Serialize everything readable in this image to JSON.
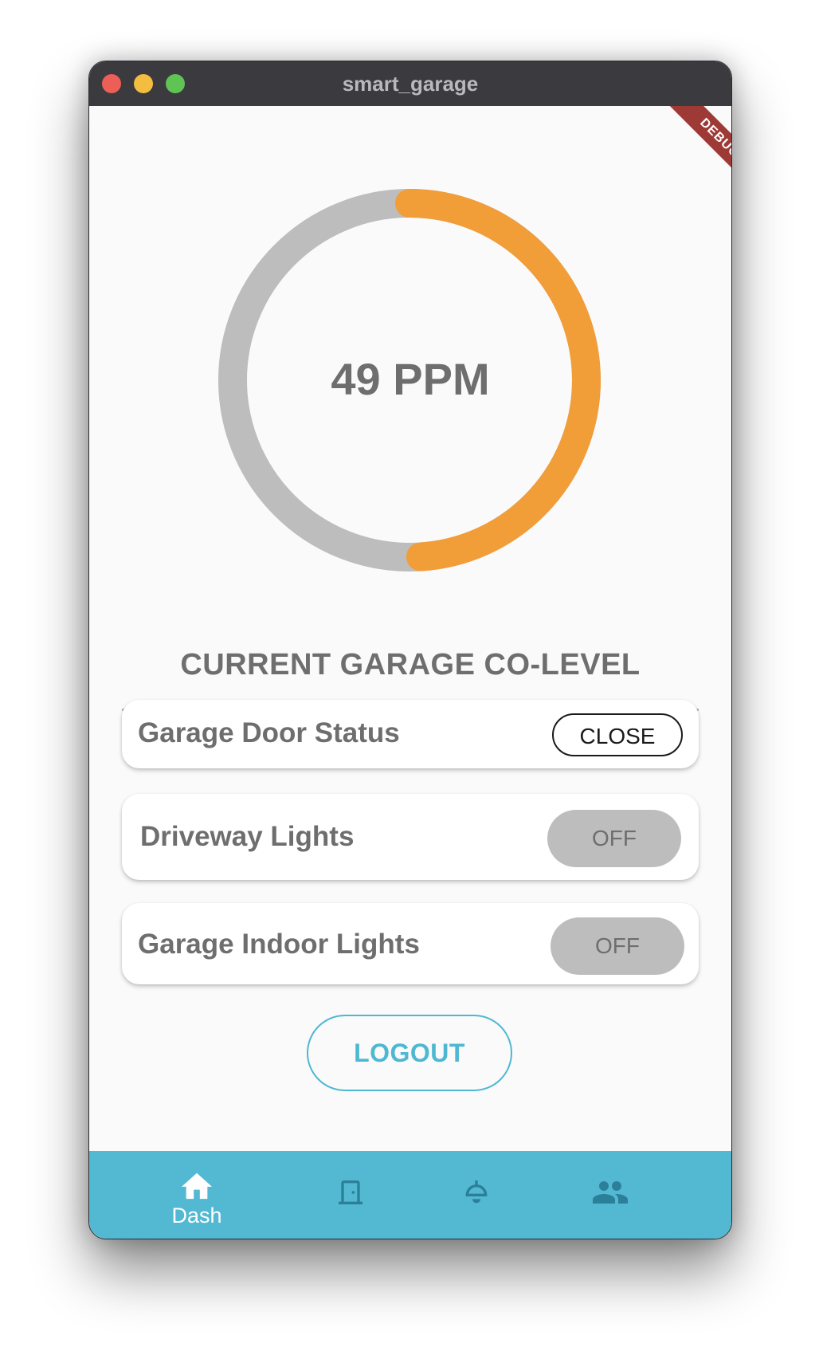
{
  "window": {
    "title": "smart_garage"
  },
  "debug_banner": "DEBUG",
  "gauge": {
    "value_text": "49 PPM",
    "fill_fraction": 0.49,
    "label": "CURRENT GARAGE CO-LEVEL",
    "colors": {
      "fill": "#f19d38",
      "track": "#bdbdbd"
    }
  },
  "controls": [
    {
      "label": "Garage Door Status",
      "button": "CLOSE"
    },
    {
      "label": "Driveway Lights",
      "button": "OFF"
    },
    {
      "label": "Garage Indoor Lights",
      "button": "OFF"
    }
  ],
  "logout_label": "LOGOUT",
  "nav": {
    "items": [
      {
        "label": "Dash",
        "icon": "home-icon",
        "active": true
      },
      {
        "label": "",
        "icon": "door-icon",
        "active": false
      },
      {
        "label": "",
        "icon": "ceiling-light-icon",
        "active": false
      },
      {
        "label": "",
        "icon": "people-icon",
        "active": false
      }
    ],
    "colors": {
      "background": "#53b9d3",
      "active": "#ffffff",
      "inactive": "#2c7f99"
    }
  }
}
